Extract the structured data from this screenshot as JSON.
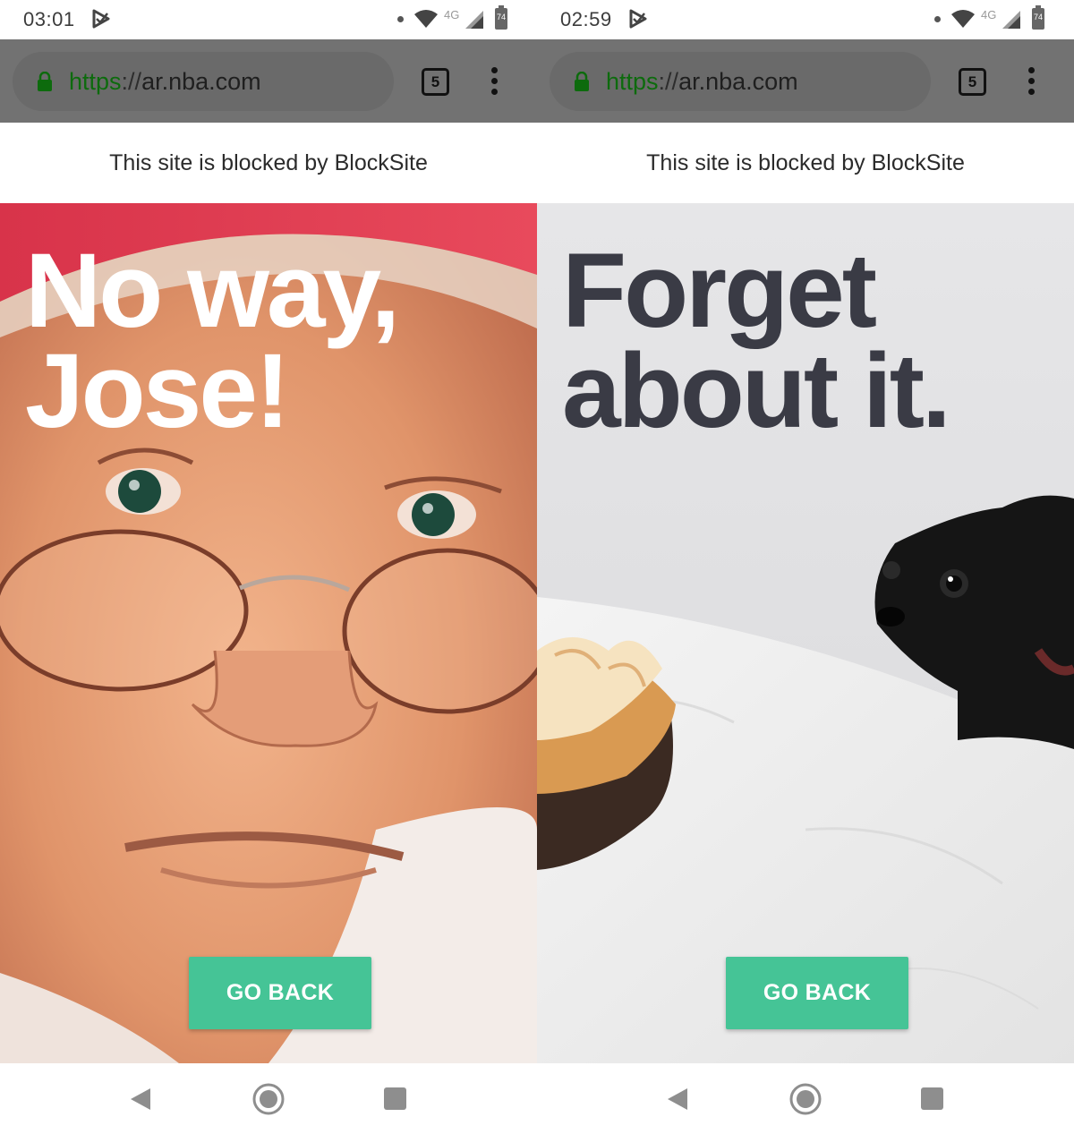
{
  "screens": [
    {
      "status": {
        "time": "03:01",
        "network": "4G",
        "battery": "74"
      },
      "browser": {
        "url_scheme": "https",
        "url_sep": "://",
        "url_host": "ar.nba.com",
        "tab_count": "5"
      },
      "blocked_message": "This site is blocked by BlockSite",
      "headline": {
        "line1": "No way,",
        "line2": "Jose!"
      },
      "go_back_label": "GO BACK"
    },
    {
      "status": {
        "time": "02:59",
        "network": "4G",
        "battery": "74"
      },
      "browser": {
        "url_scheme": "https",
        "url_sep": "://",
        "url_host": "ar.nba.com",
        "tab_count": "5"
      },
      "blocked_message": "This site is blocked by BlockSite",
      "headline": {
        "line1": "Forget",
        "line2": "about it."
      },
      "go_back_label": "GO BACK"
    }
  ],
  "icons": {
    "notification": "play-protect-icon",
    "wifi": "wifi-icon",
    "signal": "cell-signal-icon",
    "battery": "battery-icon",
    "lock": "lock-icon",
    "menu": "more-vert-icon",
    "nav_back": "back-triangle-icon",
    "nav_home": "home-circle-icon",
    "nav_recent": "recent-square-icon"
  },
  "colors": {
    "url_bar": "#727272",
    "secure_green": "#0d6b0d",
    "button_green": "#45c496",
    "dark_headline": "#3a3b45"
  }
}
